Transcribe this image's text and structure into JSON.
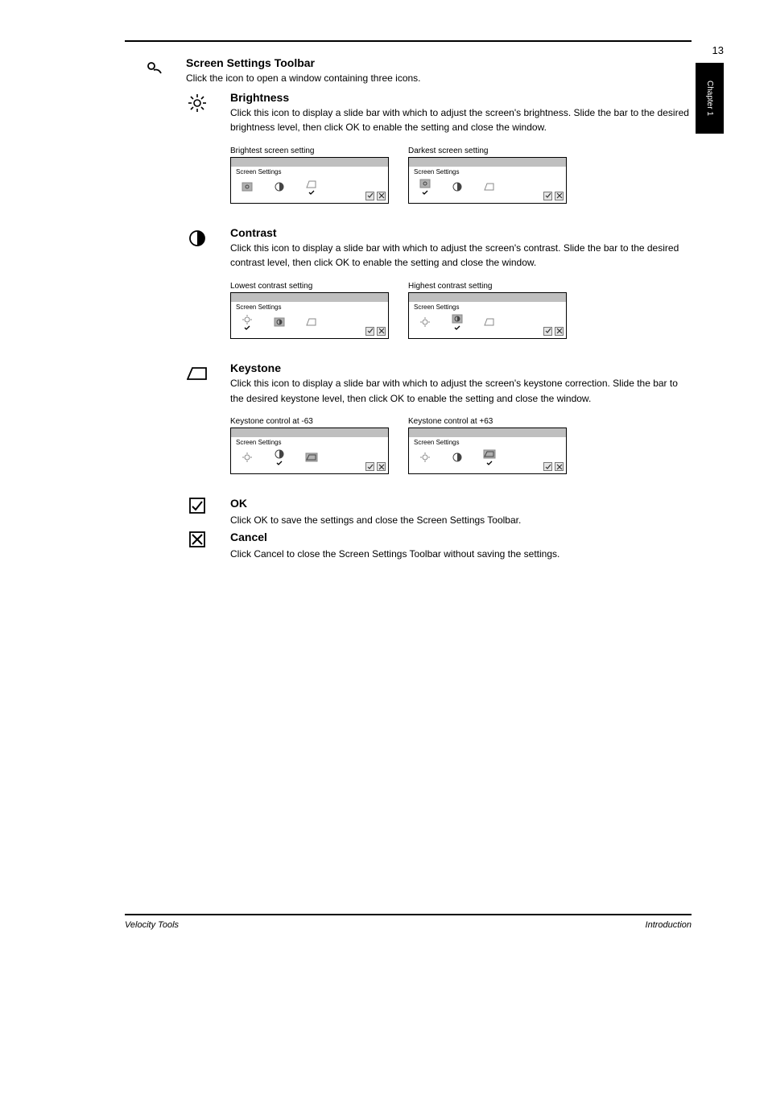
{
  "page_number": "13",
  "side_tab": "Chapter 1",
  "toolbar_title": "Screen Settings Toolbar",
  "toolbar_intro": "Click the   icon to open a window containing three icons.",
  "sections": {
    "brightness": {
      "title": "Brightness",
      "body": "Click this icon to display a slide bar with which to adjust the screen's brightness. Slide the bar to the desired brightness level, then click OK to enable the setting and close the window.",
      "bright_caption": "Brightest screen setting",
      "dark_caption": "Darkest screen setting",
      "dialog_title": "Screen Settings"
    },
    "contrast": {
      "title": "Contrast",
      "body": "Click this icon to display a slide bar with which to adjust the screen's contrast. Slide the bar to the desired contrast level, then click OK to enable the setting and close the window.",
      "low_caption": "Lowest contrast setting",
      "high_caption": "Highest contrast setting",
      "dialog_title": "Screen Settings"
    },
    "keystone": {
      "title": "Keystone",
      "body": "Click this icon to display a slide bar with which to adjust the screen's keystone correction. Slide the bar to the desired keystone level, then click OK to enable the setting and close the window.",
      "neg_caption": "Keystone control at -63",
      "pos_caption": "Keystone control at +63",
      "dialog_title": "Screen Settings"
    },
    "ok": {
      "title": "OK",
      "body": "Click OK to save the settings and close the Screen Settings Toolbar."
    },
    "cancel": {
      "title": "Cancel",
      "body": "Click Cancel to close the Screen Settings Toolbar without saving the settings."
    }
  },
  "footer": {
    "left": "Velocity Tools",
    "right": "Introduction"
  }
}
